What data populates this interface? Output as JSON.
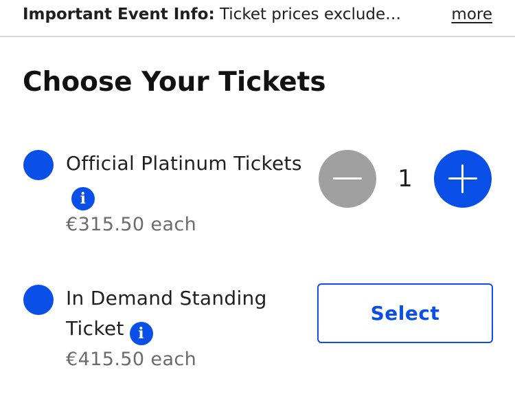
{
  "banner": {
    "label": "Important Event Info:",
    "text": "Ticket prices exclude…",
    "more_label": "more"
  },
  "section": {
    "title": "Choose Your Tickets"
  },
  "tickets": [
    {
      "name": "Official Platinum Tickets",
      "price": "€315.50 each",
      "info_icon": "info-icon",
      "quantity": "1",
      "control": "stepper"
    },
    {
      "name": "In Demand Standing Ticket",
      "price": "€415.50 each",
      "info_icon": "info-icon",
      "select_label": "Select",
      "control": "select"
    }
  ],
  "colors": {
    "accent": "#0a4fe8",
    "disabled": "#a0a0a0",
    "muted_text": "#6b6b6b"
  }
}
